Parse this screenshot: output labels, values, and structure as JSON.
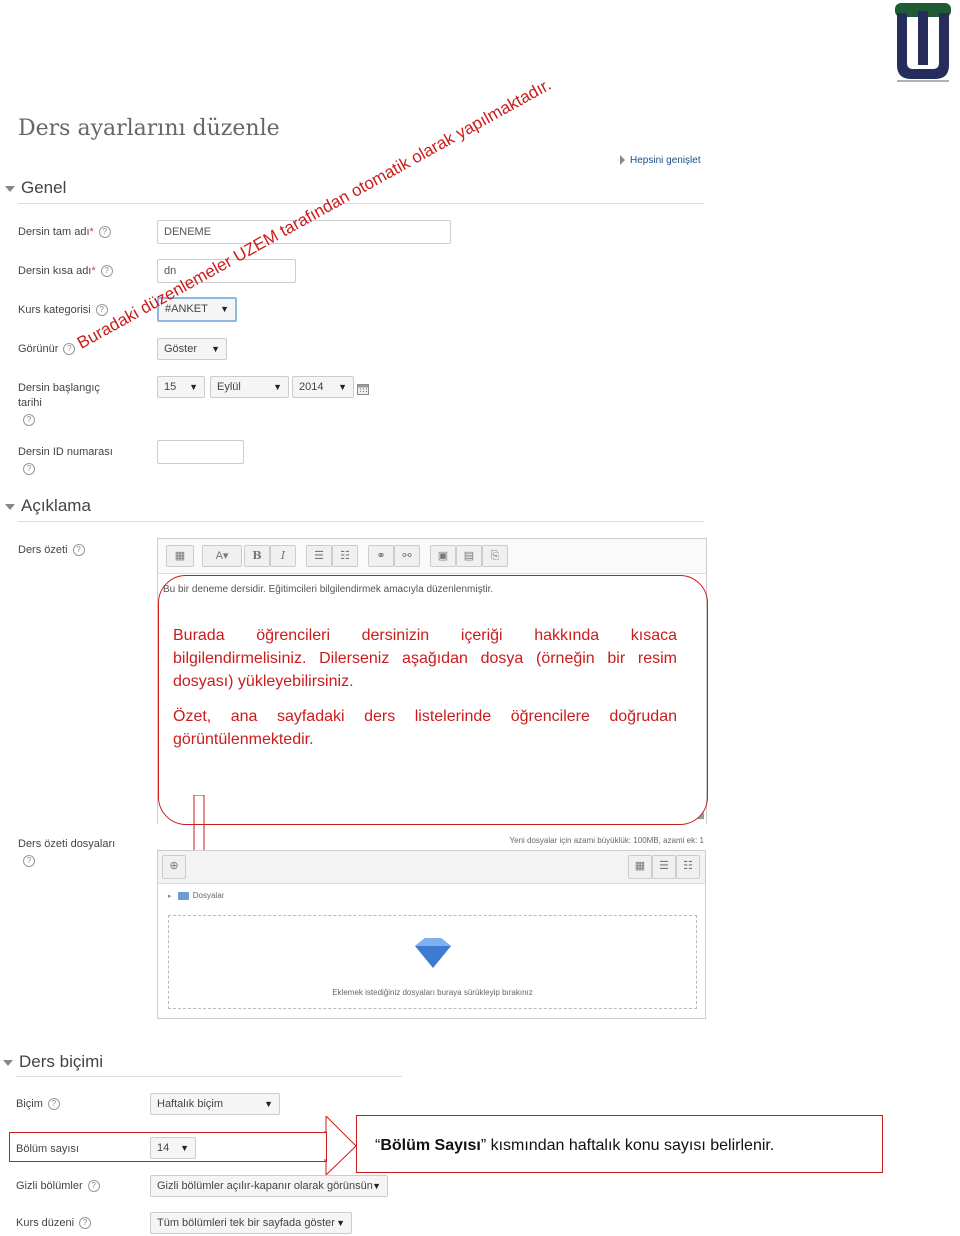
{
  "page": {
    "title": "Ders ayarlarını düzenle",
    "expand_all": "Hepsini genişlet"
  },
  "sections": {
    "general": "Genel",
    "description": "Açıklama",
    "format": "Ders biçimi"
  },
  "fields": {
    "fullname": {
      "label": "Dersin tam adı",
      "required_mark": "*",
      "value": "DENEME"
    },
    "shortname": {
      "label": "Dersin kısa adı",
      "required_mark": "*",
      "value": "dn"
    },
    "category": {
      "label": "Kurs kategorisi",
      "value": "#ANKET"
    },
    "visible": {
      "label": "Görünür",
      "value": "Göster"
    },
    "startdate": {
      "label_line1": "Dersin başlangıç",
      "label_line2": "tarihi",
      "day": "15",
      "month": "Eylül",
      "year": "2014"
    },
    "idnumber": {
      "label": "Dersin ID numarası",
      "value": ""
    },
    "summary": {
      "label": "Ders özeti",
      "text": "Bu bir deneme dersidir. Eğitimcileri bilgilendirmek amacıyla düzenlenmiştir."
    },
    "summary_files": {
      "label": "Ders özeti dosyaları",
      "limit_note": "Yeni dosyalar için azami büyüklük: 100MB, azami ek: 1",
      "folder": "Dosyalar",
      "drop_hint": "Eklemek istediğiniz dosyaları buraya sürükleyip bırakınız"
    },
    "format": {
      "label": "Biçim",
      "value": "Haftalık biçim"
    },
    "numsections": {
      "label": "Bölüm sayısı",
      "value": "14"
    },
    "hiddensections": {
      "label": "Gizli bölümler",
      "value": "Gizli bölümler açılır-kapanır olarak görünsün"
    },
    "coursedisplay": {
      "label": "Kurs düzeni",
      "value": "Tüm bölümleri tek bir sayfada göster"
    }
  },
  "annotations": {
    "diagonal": "Buradaki düzenlemeler UZEM tarafından otomatik olarak yapılmaktadır.",
    "summary_p1": "Burada öğrencileri dersinizin içeriği hakkında kısaca bilgilendirmelisiniz. Dilerseniz aşağıdan dosya (örneğin bir resim dosyası) yükleyebilirsiniz.",
    "summary_p2": "Özet, ana sayfadaki ders listelerinde öğrencilere doğrudan görüntülenmektedir.",
    "section_count_bold": "Bölüm Sayısı",
    "section_count_rest": " kısmından haftalık konu sayısı belirlenir.",
    "open_quote": "“",
    "close_quote": "”"
  },
  "icons": {
    "help": "?",
    "calendar": "calendar-icon",
    "logo": "university-logo"
  },
  "colors": {
    "annotation_red": "#cc1b1b",
    "logo_navy": "#262c5c",
    "logo_green": "#1f5c34",
    "link_blue": "#1a4f8a"
  }
}
